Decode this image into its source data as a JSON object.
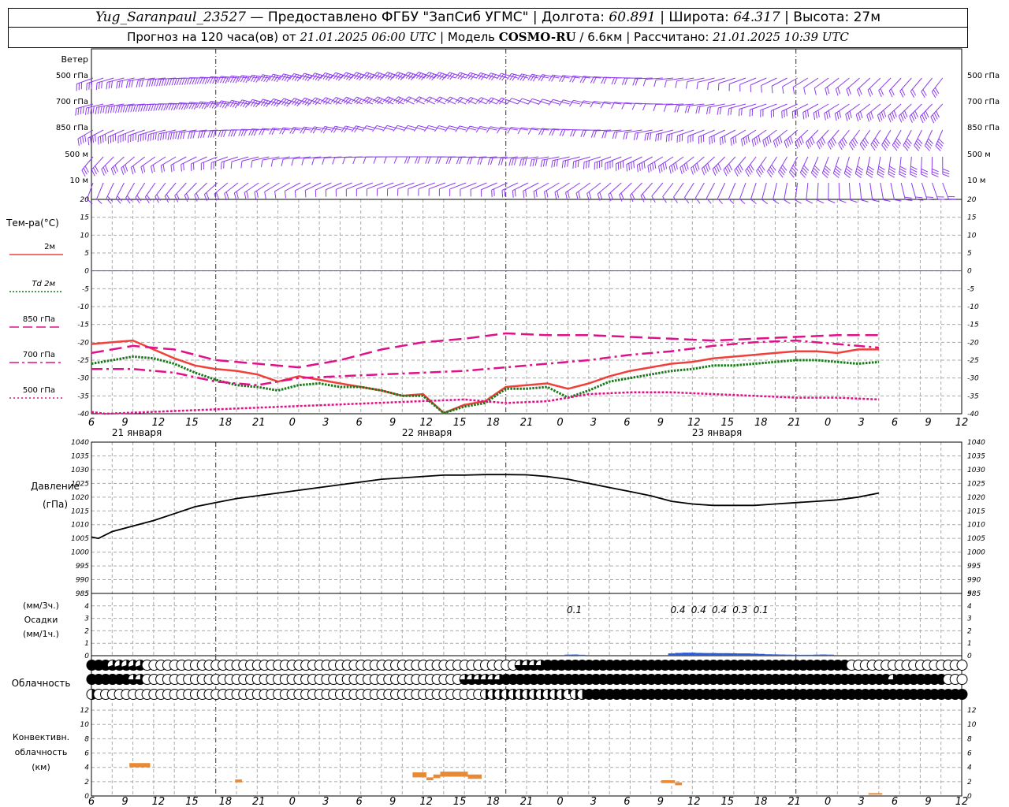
{
  "header": {
    "station": "Yug_Saranpaul_23527",
    "sep1": " — ",
    "provider": "Предоставлено ФГБУ \"ЗапСиб УГМС\"",
    "lon_label": " | Долгота: ",
    "lon": "60.891",
    "lat_label": " | Широта: ",
    "lat": "64.317",
    "alt_label": " | Высота: ",
    "alt": "27м",
    "forecast_label": "Прогноз на 120 часа(ов) от ",
    "forecast_start": "21.01.2025 06:00 UTC",
    "model_label": " | Модель ",
    "model": "COSMO-RU",
    "resolution": " / 6.6км",
    "calc_label": " | Рассчитано: ",
    "calc_time": "21.01.2025 10:39 UTC"
  },
  "colors": {
    "wind": "#8c3cf0",
    "t2m": "#f0403c",
    "td2m": "#1a7a1a",
    "level": "#e0108a",
    "zero_line": "#3d5bd8",
    "precip": "#2a5ad8",
    "convective": "#e88a34",
    "pressure": "#000000",
    "grid": "#aaaaaa"
  },
  "time_axis": {
    "hour_ticks": [
      "6",
      "9",
      "12",
      "15",
      "18",
      "21",
      "0",
      "3",
      "6",
      "9",
      "12",
      "15",
      "18",
      "21",
      "0",
      "3",
      "6",
      "9",
      "12",
      "15",
      "18",
      "21",
      "0",
      "3",
      "6",
      "9",
      "12"
    ],
    "day_labels": [
      "21 января",
      "22 января",
      "23 января"
    ]
  },
  "wind_panel": {
    "title": "Ветер",
    "levels": [
      "500 гПа",
      "700 гПа",
      "850 гПа",
      "500 м",
      "10 м"
    ]
  },
  "temperature_panel": {
    "title": "Тем-ра(°C)",
    "legend": [
      {
        "label": "2м",
        "style": "solid",
        "color_key": "t2m"
      },
      {
        "label": "Td 2м",
        "style": "dotted",
        "color_key": "td2m"
      },
      {
        "label": "850 гПа",
        "style": "dash",
        "color_key": "level"
      },
      {
        "label": "700 гПа",
        "style": "dashdot",
        "color_key": "level"
      },
      {
        "label": "500 гПа",
        "style": "dots",
        "color_key": "level"
      }
    ],
    "ylim": [
      -40,
      20
    ],
    "y_ticks": [
      "20",
      "15",
      "10",
      "5",
      "0",
      "-5",
      "-10",
      "-15",
      "-20",
      "-25",
      "-30",
      "-35",
      "-40"
    ]
  },
  "pressure_panel": {
    "title": "Давление",
    "unit": "(гПа)",
    "ylim": [
      985,
      1040
    ],
    "y_ticks": [
      "1040",
      "1035",
      "1030",
      "1025",
      "1020",
      "1015",
      "1010",
      "1005",
      "1000",
      "995",
      "990",
      "985"
    ]
  },
  "precip_panel": {
    "unit3": "(мм/3ч.)",
    "title": "Осадки",
    "unit1": "(мм/1ч.)",
    "ylim": [
      0,
      5
    ],
    "y_ticks": [
      "5",
      "4",
      "3",
      "2",
      "1",
      "0"
    ],
    "labels": [
      {
        "h": 69,
        "text": "0.1"
      },
      {
        "h": 84,
        "text": "0.4"
      },
      {
        "h": 87,
        "text": "0.4"
      },
      {
        "h": 90,
        "text": "0.4"
      },
      {
        "h": 93,
        "text": "0.3"
      },
      {
        "h": 96,
        "text": "0.1"
      }
    ]
  },
  "cloud_panel": {
    "title": "Облачность"
  },
  "convective_panel": {
    "title1": "Конвективн.",
    "title2": "облачность",
    "unit": "(км)",
    "ylim": [
      0,
      13
    ],
    "y_ticks": [
      "12",
      "10",
      "8",
      "6",
      "4",
      "2",
      "0"
    ]
  },
  "chart_data": [
    {
      "type": "line",
      "name": "wind",
      "levels": [
        "500 гПа",
        "700 гПа",
        "850 гПа",
        "500 м",
        "10 м"
      ]
    },
    {
      "type": "line",
      "x_unit": "hours since 21.01.2025 06:00 UTC",
      "title": "Тем-ра(°C)",
      "ylim": [
        -40,
        20
      ],
      "series": [
        {
          "name": "2м",
          "x": [
            0,
            3,
            6,
            9,
            12,
            15,
            18,
            21,
            24,
            27,
            30,
            33,
            36,
            39,
            42,
            45,
            48,
            51,
            54,
            57,
            60,
            63,
            66,
            69,
            72,
            75,
            78,
            81,
            84,
            87,
            90,
            93,
            96,
            99,
            102,
            105,
            108,
            111,
            114
          ],
          "values": [
            -20.5,
            -20,
            -19.5,
            -22,
            -24.5,
            -26.5,
            -27.5,
            -28,
            -29,
            -31,
            -29.5,
            -30.5,
            -31.5,
            -32.5,
            -33.5,
            -35,
            -34.5,
            -39.8,
            -37.5,
            -36.5,
            -32.5,
            -32,
            -31.5,
            -33,
            -31.5,
            -29.5,
            -28,
            -27,
            -26,
            -25.5,
            -24.5,
            -24,
            -23.5,
            -23,
            -22.5,
            -22.5,
            -23,
            -22,
            -22
          ]
        },
        {
          "name": "Td 2м",
          "x": [
            0,
            3,
            6,
            9,
            12,
            15,
            18,
            21,
            24,
            27,
            30,
            33,
            36,
            39,
            42,
            45,
            48,
            51,
            54,
            57,
            60,
            63,
            66,
            69,
            72,
            75,
            78,
            81,
            84,
            87,
            90,
            93,
            96,
            99,
            102,
            105,
            108,
            111,
            114
          ],
          "values": [
            -26,
            -25,
            -24,
            -24.5,
            -26,
            -28.5,
            -30.5,
            -32,
            -32.5,
            -33.5,
            -32,
            -31.5,
            -32.5,
            -32.5,
            -33.5,
            -35,
            -35,
            -39.8,
            -38,
            -37,
            -33,
            -33,
            -32.5,
            -35.5,
            -33.5,
            -31,
            -30,
            -29,
            -28,
            -27.5,
            -26.5,
            -26.5,
            -26,
            -25.5,
            -25,
            -25,
            -25.5,
            -26,
            -25.5
          ]
        },
        {
          "name": "850 гПа",
          "x": [
            0,
            6,
            12,
            18,
            24,
            30,
            36,
            42,
            48,
            54,
            60,
            66,
            72,
            78,
            84,
            90,
            96,
            102,
            108,
            114
          ],
          "values": [
            -23,
            -21,
            -22,
            -25,
            -26,
            -27,
            -25,
            -22,
            -20,
            -19,
            -17.5,
            -18,
            -18,
            -18.5,
            -19,
            -19.5,
            -19,
            -18.5,
            -18,
            -18
          ]
        },
        {
          "name": "700 гПа",
          "x": [
            0,
            6,
            12,
            18,
            24,
            30,
            36,
            42,
            48,
            54,
            60,
            66,
            72,
            78,
            84,
            90,
            96,
            102,
            108,
            114
          ],
          "values": [
            -27.5,
            -27.5,
            -28.5,
            -31,
            -32,
            -30,
            -29.5,
            -29,
            -28.5,
            -28,
            -27,
            -26,
            -25,
            -23.5,
            -22.5,
            -21,
            -20,
            -19.5,
            -20.5,
            -21.5
          ]
        },
        {
          "name": "500 гПа",
          "x": [
            0,
            2,
            54,
            60,
            66,
            72,
            78,
            84,
            90,
            96,
            102,
            108,
            114
          ],
          "values": [
            -39.5,
            -40,
            -36,
            -37,
            -36.5,
            -34.5,
            -34,
            -34,
            -34.5,
            -35,
            -35.5,
            -35.5,
            -36
          ]
        }
      ]
    },
    {
      "type": "line",
      "x_unit": "hours since 21.01.2025 06:00 UTC",
      "title": "Давление",
      "ylabel": "(гПа)",
      "ylim": [
        985,
        1040
      ],
      "series": [
        {
          "name": "Давление",
          "x": [
            0,
            1,
            3,
            6,
            9,
            12,
            15,
            18,
            21,
            24,
            27,
            30,
            33,
            36,
            39,
            42,
            45,
            48,
            51,
            54,
            57,
            60,
            63,
            66,
            69,
            72,
            75,
            78,
            81,
            84,
            87,
            90,
            93,
            96,
            99,
            102,
            105,
            108,
            111,
            114
          ],
          "values": [
            1005.5,
            1005,
            1007.5,
            1009.5,
            1011.5,
            1014,
            1016.5,
            1018,
            1019.5,
            1020.5,
            1021.5,
            1022.5,
            1023.5,
            1024.5,
            1025.5,
            1026.5,
            1027,
            1027.5,
            1028,
            1028,
            1028.2,
            1028.2,
            1028.1,
            1027.5,
            1026.5,
            1025,
            1023.5,
            1022,
            1020.5,
            1018.5,
            1017.5,
            1017,
            1017,
            1017,
            1017.5,
            1018,
            1018.5,
            1019,
            1020,
            1021.5
          ]
        }
      ]
    },
    {
      "type": "bar",
      "x_unit": "hours since 21.01.2025 06:00 UTC",
      "title": "Осадки",
      "ylabel": "(мм/1ч.)",
      "ylim": [
        0,
        5
      ],
      "x": [
        69,
        70,
        71,
        84,
        85,
        86,
        87,
        88,
        89,
        90,
        91,
        92,
        93,
        94,
        95,
        96,
        97,
        98,
        99,
        100,
        101,
        102,
        103,
        104,
        105,
        106,
        107,
        108
      ],
      "values": [
        0.02,
        0.03,
        0.01,
        0.12,
        0.16,
        0.18,
        0.18,
        0.16,
        0.15,
        0.15,
        0.14,
        0.14,
        0.13,
        0.12,
        0.12,
        0.1,
        0.08,
        0.05,
        0.04,
        0.03,
        0.02,
        0.01,
        0.01,
        0.01,
        0.02,
        0.03,
        0.02,
        0.0
      ],
      "labels_3h": [
        {
          "x": 69,
          "value": "0.1"
        },
        {
          "x": 84,
          "value": "0.4"
        },
        {
          "x": 87,
          "value": "0.4"
        },
        {
          "x": 90,
          "value": "0.4"
        },
        {
          "x": 93,
          "value": "0.3"
        },
        {
          "x": 96,
          "value": "0.1"
        }
      ]
    },
    {
      "type": "bar",
      "x_unit": "hours since 21.01.2025 06:00 UTC",
      "title": "Конвективн. облачность",
      "ylabel": "(км)",
      "ylim": [
        0,
        13
      ],
      "segments": [
        {
          "x0": 5.5,
          "x1": 8.5,
          "base": 4.0,
          "top": 4.6
        },
        {
          "x0": 20.8,
          "x1": 21.8,
          "base": 1.9,
          "top": 2.3
        },
        {
          "x0": 46.5,
          "x1": 48.5,
          "base": 2.6,
          "top": 3.3
        },
        {
          "x0": 48.5,
          "x1": 49.5,
          "base": 2.2,
          "top": 2.6
        },
        {
          "x0": 49.5,
          "x1": 50.5,
          "base": 2.5,
          "top": 3.0
        },
        {
          "x0": 50.5,
          "x1": 54.5,
          "base": 2.7,
          "top": 3.4
        },
        {
          "x0": 54.5,
          "x1": 56.5,
          "base": 2.4,
          "top": 3.0
        },
        {
          "x0": 82.5,
          "x1": 84.5,
          "base": 1.8,
          "top": 2.2
        },
        {
          "x0": 84.5,
          "x1": 85.5,
          "base": 1.5,
          "top": 1.9
        },
        {
          "x0": 112.5,
          "x1": 114.5,
          "base": 0.2,
          "top": 0.4
        }
      ]
    }
  ]
}
